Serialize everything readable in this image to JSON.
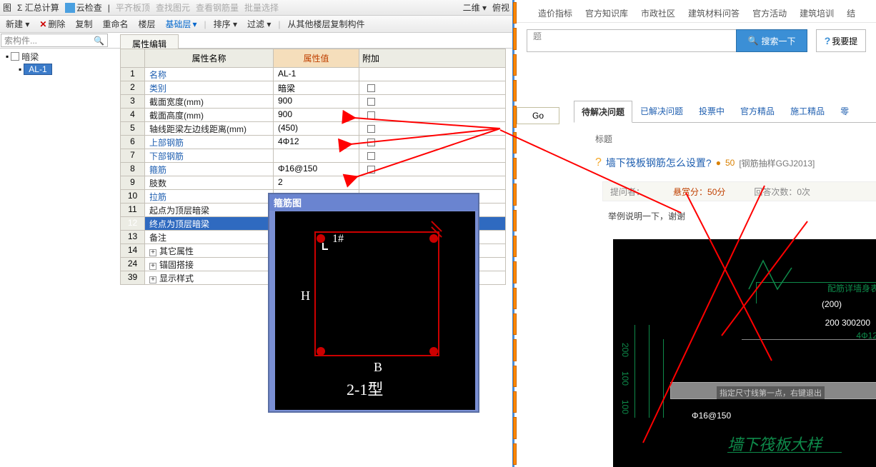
{
  "toolbar1": {
    "tu": "图",
    "sum": "Σ 汇总计算",
    "cloud": "云检查",
    "flat": "平齐板顶",
    "find": "查找图元",
    "steel": "查看钢筋量",
    "batch": "批量选择",
    "view2d": "二维 ▾",
    "look": "俯视"
  },
  "toolbar2": {
    "new": "新建 ▾",
    "del": "删除",
    "copy": "复制",
    "rename": "重命名",
    "floor": "楼层",
    "base": "基础层",
    "sort": "排序 ▾",
    "filter": "过滤 ▾",
    "copyfrom": "从其他楼层复制构件"
  },
  "search": {
    "placeholder": "索构件..."
  },
  "tree": {
    "dark": "暗梁",
    "al1": "AL-1"
  },
  "prop_tab": "属性编辑",
  "prop_head": {
    "name": "属性名称",
    "val": "属性值",
    "add": "附加"
  },
  "rows": [
    {
      "n": "1",
      "name": "名称",
      "val": "AL-1",
      "dark": false,
      "chk": false
    },
    {
      "n": "2",
      "name": "类别",
      "val": "暗梁",
      "dark": false,
      "chk": true
    },
    {
      "n": "3",
      "name": "截面宽度(mm)",
      "val": "900",
      "dark": true,
      "chk": true
    },
    {
      "n": "4",
      "name": "截面高度(mm)",
      "val": "900",
      "dark": true,
      "chk": true
    },
    {
      "n": "5",
      "name": "轴线距梁左边线距离(mm)",
      "val": "(450)",
      "dark": true,
      "chk": true
    },
    {
      "n": "6",
      "name": "上部钢筋",
      "val": "4Φ12",
      "dark": false,
      "chk": true
    },
    {
      "n": "7",
      "name": "下部钢筋",
      "val": "",
      "dark": false,
      "chk": true
    },
    {
      "n": "8",
      "name": "箍筋",
      "val": "Φ16@150",
      "dark": false,
      "chk": true
    },
    {
      "n": "9",
      "name": "肢数",
      "val": "2",
      "dark": true,
      "chk": false
    },
    {
      "n": "10",
      "name": "拉筋",
      "val": "",
      "dark": false,
      "chk": false
    },
    {
      "n": "11",
      "name": "起点为顶层暗梁",
      "val": "",
      "dark": true,
      "chk": false
    },
    {
      "n": "12",
      "name": "终点为顶层暗梁",
      "val": "",
      "dark": true,
      "chk": false,
      "sel": true
    },
    {
      "n": "13",
      "name": "备注",
      "val": "",
      "dark": true,
      "chk": false
    }
  ],
  "exp_rows": [
    {
      "n": "14",
      "name": "其它属性"
    },
    {
      "n": "24",
      "name": "锚固搭接"
    },
    {
      "n": "39",
      "name": "显示样式"
    }
  ],
  "diagram": {
    "title": "箍筋图",
    "hash": "1#",
    "h": "H",
    "b": "B",
    "type": "2-1型"
  },
  "right": {
    "nav": [
      "造价指标",
      "官方知识库",
      "市政社区",
      "建筑材料问答",
      "官方活动",
      "建筑培训",
      "结"
    ],
    "search_placeholder": "题",
    "search_btn": "搜索一下",
    "help": "我要提",
    "go": "Go",
    "tabs": [
      "待解决问题",
      "已解决问题",
      "投票中",
      "官方精品",
      "施工精品",
      "零"
    ],
    "title": "标题",
    "q": "墙下筏板钢筋怎么设置?",
    "coin": "50",
    "tag": "[钢筋抽样GGJ2013]",
    "asker": "提问者：",
    "reward": "悬赏分：50分",
    "answers": "回答次数：0次",
    "desc": "举例说明一下，谢谢",
    "img": {
      "t1": "配筋详墙身表",
      "d1": "(200)",
      "d2": "200 300200",
      "rebar": "4Φ12",
      "tip": "指定尺寸线第一点，右键退出",
      "btm": "Φ16@150",
      "title": "墙下筏板大样"
    }
  }
}
